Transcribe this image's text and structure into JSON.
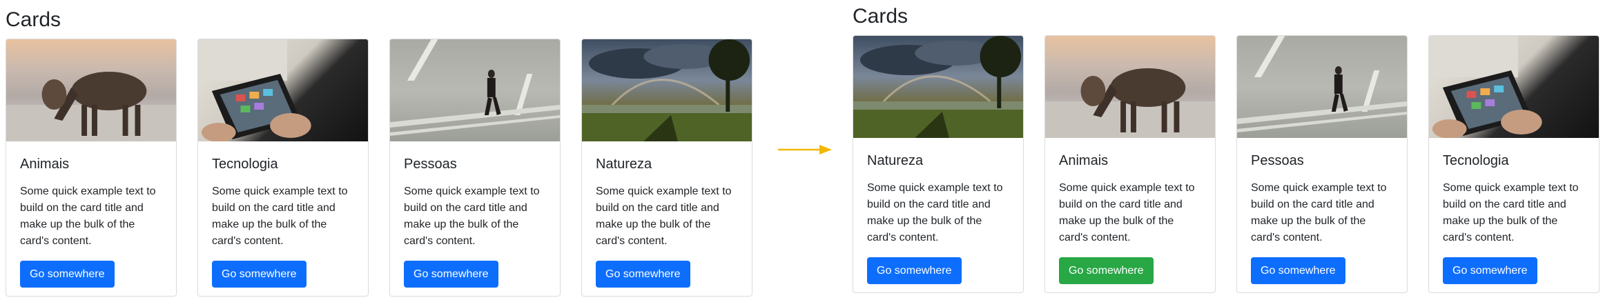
{
  "left": {
    "title": "Cards",
    "cards": [
      {
        "image": "horse-grazing-photo",
        "title": "Animais",
        "text": "Some quick example text to build on the card title and make up the bulk of the card's content.",
        "button": "Go somewhere",
        "button_color": "#0d6efd"
      },
      {
        "image": "tablet-hands-photo",
        "title": "Tecnologia",
        "text": "Some quick example text to build on the card title and make up the bulk of the card's content.",
        "button": "Go somewhere",
        "button_color": "#0d6efd"
      },
      {
        "image": "person-walking-road-photo",
        "title": "Pessoas",
        "text": "Some quick example text to build on the card title and make up the bulk of the card's content.",
        "button": "Go somewhere",
        "button_color": "#0d6efd"
      },
      {
        "image": "rainbow-landscape-photo",
        "title": "Natureza",
        "text": "Some quick example text to build on the card title and make up the bulk of the card's content.",
        "button": "Go somewhere",
        "button_color": "#0d6efd"
      }
    ]
  },
  "arrow": {
    "icon": "arrow-right-icon",
    "color": "#f2b705"
  },
  "right": {
    "title": "Cards",
    "cards": [
      {
        "image": "rainbow-landscape-photo",
        "title": "Natureza",
        "text": "Some quick example text to build on the card title and make up the bulk of the card's content.",
        "button": "Go somewhere",
        "button_color": "#0d6efd"
      },
      {
        "image": "horse-grazing-photo",
        "title": "Animais",
        "text": "Some quick example text to build on the card title and make up the bulk of the card's content.",
        "button": "Go somewhere",
        "button_color": "#28a745"
      },
      {
        "image": "person-walking-road-photo",
        "title": "Pessoas",
        "text": "Some quick example text to build on the card title and make up the bulk of the card's content.",
        "button": "Go somewhere",
        "button_color": "#0d6efd"
      },
      {
        "image": "tablet-hands-photo",
        "title": "Tecnologia",
        "text": "Some quick example text to build on the card title and make up the bulk of the card's content.",
        "button": "Go somewhere",
        "button_color": "#0d6efd"
      }
    ]
  }
}
